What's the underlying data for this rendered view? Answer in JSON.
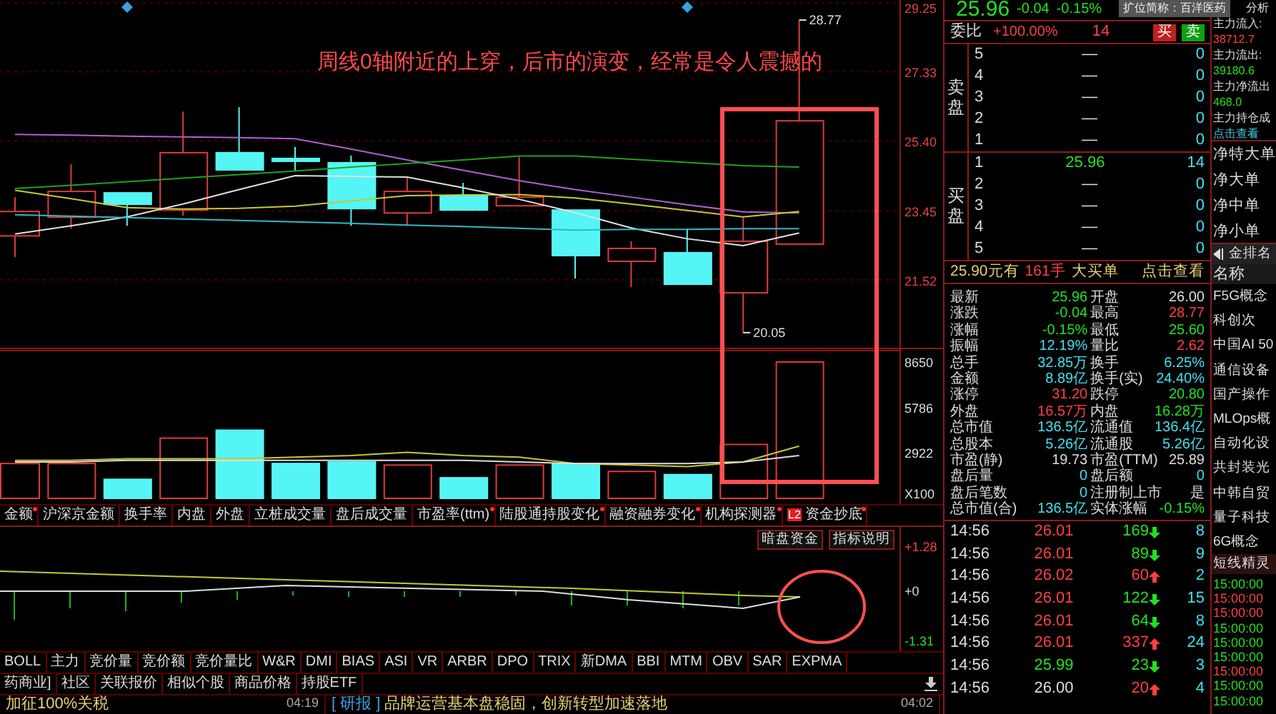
{
  "price_chart": {
    "annotation": "周线0轴附近的上穿，后市的演变，经常是令人震撼的",
    "high_label": "28.77",
    "low_label": "20.05",
    "chart_data": {
      "type": "line",
      "grid": true,
      "ylim": [
        19.61,
        29.33
      ],
      "yticks": [
        {
          "value": 21.52,
          "label": "21.52"
        },
        {
          "value": 23.45,
          "label": "23.45"
        },
        {
          "value": 25.4,
          "label": "25.40"
        },
        {
          "value": 27.33,
          "label": "27.33"
        },
        {
          "value": 29.25,
          "label": "29.25"
        }
      ],
      "series": [
        {
          "color": "#b060d0",
          "values": [
            25.58,
            25.56,
            25.53,
            25.51,
            25.49,
            25.46,
            25.17,
            24.87,
            24.58,
            24.29,
            24.04,
            23.83,
            23.62,
            23.42,
            23.39
          ]
        },
        {
          "color": "#20a020",
          "values": [
            24.07,
            24.16,
            24.26,
            24.36,
            24.46,
            24.56,
            24.67,
            24.77,
            24.87,
            24.98,
            24.98,
            24.89,
            24.8,
            24.71,
            24.67
          ]
        },
        {
          "color": "#c8c830",
          "values": [
            24.02,
            23.79,
            23.54,
            23.5,
            23.52,
            23.58,
            23.73,
            23.87,
            23.89,
            23.9,
            23.81,
            23.64,
            23.46,
            23.28,
            23.43
          ]
        },
        {
          "color": "#e0e0e0",
          "values": [
            22.8,
            23.03,
            23.28,
            23.64,
            24.04,
            24.43,
            24.41,
            24.39,
            24.09,
            23.77,
            23.4,
            22.97,
            22.67,
            22.48,
            22.83
          ]
        },
        {
          "color": "#30b8c8",
          "values": [
            23.34,
            23.3,
            23.26,
            23.22,
            23.18,
            23.14,
            23.1,
            23.05,
            23.01,
            22.96,
            22.91,
            22.93,
            22.93,
            22.95,
            22.95
          ]
        }
      ]
    }
  },
  "volume_chart": {
    "chart_data": {
      "type": "bar",
      "ylabel": "X100",
      "ylim": [
        0,
        9366
      ],
      "yticks": [
        2922,
        5786,
        8650
      ],
      "series": [
        {
          "color": "#e03a3a",
          "values": [
            2200,
            2200,
            null,
            3800,
            null,
            null,
            null,
            2100,
            null,
            2100,
            null,
            1700,
            null,
            3400,
            8600
          ]
        },
        {
          "color": "#55f5f5",
          "values": [
            null,
            null,
            1200,
            null,
            4300,
            2200,
            2300,
            null,
            1300,
            null,
            2200,
            null,
            1500,
            null,
            null
          ]
        },
        {
          "type": "line",
          "color": "#c8c830",
          "values": [
            2400,
            2400,
            2500,
            2500,
            2500,
            2600,
            2700,
            2900,
            2700,
            2600,
            2200,
            2100,
            2000,
            2300,
            3300
          ]
        },
        {
          "type": "line",
          "color": "#dddddd",
          "values": [
            2300,
            2300,
            2400,
            2400,
            2400,
            2400,
            2400,
            2400,
            2400,
            2300,
            2200,
            2200,
            2200,
            2300,
            2700
          ]
        }
      ]
    }
  },
  "data_tabs": [
    {
      "label": "金额",
      "dot": true
    },
    {
      "label": "沪深京金额",
      "dot": false
    },
    {
      "label": "换手率",
      "dot": false
    },
    {
      "label": "内盘",
      "dot": false
    },
    {
      "label": "外盘",
      "dot": false
    },
    {
      "label": "立桩成交量",
      "dot": false
    },
    {
      "label": "盘后成交量",
      "dot": false
    },
    {
      "label": "市盈率(ttm)",
      "dot": true
    },
    {
      "label": "陆股通持股变化",
      "dot": true
    },
    {
      "label": "融资融券变化",
      "dot": true
    },
    {
      "label": "机构探测器",
      "dot": true
    },
    {
      "label": "资金抄底",
      "dot": true,
      "badge": "L2"
    }
  ],
  "indicator_chart": {
    "buttons": [
      "暗盘资金",
      "指标说明"
    ],
    "axis_labels": [
      "+1.28",
      "+0",
      "-1.31"
    ]
  },
  "indicator_tabs": [
    "BOLL",
    "主力",
    "竞价量",
    "竞价额",
    "竞价量比",
    "W&R",
    "DMI",
    "BIAS",
    "ASI",
    "VR",
    "ARBR",
    "DPO",
    "TRIX",
    "新DMA",
    "BBI",
    "MTM",
    "OBV",
    "SAR",
    "EXPMA"
  ],
  "info_tabs": [
    "药商业]",
    "社区",
    "关联报价",
    "相似个股",
    "商品价格",
    "持股ETF"
  ],
  "news": [
    {
      "title": "加征100%关税",
      "time": "04:19"
    },
    {
      "tag": "[ 研报 ]",
      "title": "品牌运营基本盘稳固，创新转型加速落地",
      "time": "04:02"
    }
  ],
  "quote": {
    "price": "25.96",
    "change": "-0.04",
    "percent": "-0.15%",
    "tooltip": "扩位简称：百洋医药"
  },
  "weibi": {
    "label": "委比",
    "value": "+100.00%",
    "diff": "14",
    "buttons": [
      {
        "label": "买",
        "kind": "buy"
      },
      {
        "label": "卖",
        "kind": "sell"
      }
    ]
  },
  "sell_side": {
    "side_label": "卖盘",
    "levels": [
      {
        "level": "5",
        "price": "—",
        "volume": "0",
        "color": "#dddddd"
      },
      {
        "level": "4",
        "price": "—",
        "volume": "0",
        "color": "#dddddd"
      },
      {
        "level": "3",
        "price": "—",
        "volume": "0",
        "color": "#dddddd"
      },
      {
        "level": "2",
        "price": "—",
        "volume": "0",
        "color": "#dddddd"
      },
      {
        "level": "1",
        "price": "—",
        "volume": "0",
        "color": "#dddddd"
      }
    ]
  },
  "buy_side": {
    "side_label": "买盘",
    "levels": [
      {
        "level": "1",
        "price": "25.96",
        "volume": "14",
        "color": "#22e022"
      },
      {
        "level": "2",
        "price": "—",
        "volume": "0",
        "color": "#dddddd"
      },
      {
        "level": "3",
        "price": "—",
        "volume": "0",
        "color": "#dddddd"
      },
      {
        "level": "4",
        "price": "—",
        "volume": "0",
        "color": "#dddddd"
      },
      {
        "level": "5",
        "price": "—",
        "volume": "0",
        "color": "#dddddd"
      }
    ]
  },
  "big_order": {
    "price": "25.90元有",
    "lots": "161手",
    "type": "大买单",
    "link": "点击查看"
  },
  "stats": [
    {
      "label": "最新",
      "value": "25.96",
      "color": "#22e022"
    },
    {
      "label": "开盘",
      "value": "26.00",
      "color": "#dddddd"
    },
    {
      "label": "涨跌",
      "value": "-0.04",
      "color": "#22e022"
    },
    {
      "label": "最高",
      "value": "28.77",
      "color": "#ff4040"
    },
    {
      "label": "涨幅",
      "value": "-0.15%",
      "color": "#22e022"
    },
    {
      "label": "最低",
      "value": "25.60",
      "color": "#22e022"
    },
    {
      "label": "振幅",
      "value": "12.19%",
      "color": "#40e0f0"
    },
    {
      "label": "量比",
      "value": "2.62",
      "color": "#ff4040"
    },
    {
      "label": "总手",
      "value": "32.85万",
      "color": "#40e0f0"
    },
    {
      "label": "换手",
      "value": "6.25%",
      "color": "#40e0f0"
    },
    {
      "label": "金额",
      "value": "8.89亿",
      "color": "#40e0f0"
    },
    {
      "label": "换手(实)",
      "value": "24.40%",
      "color": "#40e0f0"
    },
    {
      "label": "涨停",
      "value": "31.20",
      "color": "#ff4040"
    },
    {
      "label": "跌停",
      "value": "20.80",
      "color": "#22e022"
    },
    {
      "label": "外盘",
      "value": "16.57万",
      "color": "#ff4040"
    },
    {
      "label": "内盘",
      "value": "16.28万",
      "color": "#22e022"
    },
    {
      "label": "总市值",
      "value": "136.5亿",
      "color": "#40e0f0"
    },
    {
      "label": "流通值",
      "value": "136.4亿",
      "color": "#40e0f0"
    },
    {
      "label": "总股本",
      "value": "5.26亿",
      "color": "#40e0f0"
    },
    {
      "label": "流通股",
      "value": "5.26亿",
      "color": "#40e0f0"
    },
    {
      "label": "市盈(静)",
      "value": "19.73",
      "color": "#dddddd"
    },
    {
      "label": "市盈(TTM)",
      "value": "25.89",
      "color": "#dddddd"
    },
    {
      "label": "盘后量",
      "value": "0",
      "color": "#40e0f0"
    },
    {
      "label": "盘后额",
      "value": "0",
      "color": "#40e0f0"
    },
    {
      "label": "盘后笔数",
      "value": "0",
      "color": "#40e0f0"
    },
    {
      "label": "注册制上市",
      "value": "是",
      "color": "#dddddd"
    },
    {
      "label": "总市值(合)",
      "value": "136.5亿",
      "color": "#40e0f0"
    },
    {
      "label": "实体涨幅",
      "value": "-0.15%",
      "color": "#22e022"
    }
  ],
  "ticks": [
    {
      "time": "14:56",
      "price": "26.01",
      "color": "#ff4040",
      "volume": "169",
      "kind": "down",
      "count": "8"
    },
    {
      "time": "14:56",
      "price": "26.01",
      "color": "#ff4040",
      "volume": "89",
      "kind": "down",
      "count": "9"
    },
    {
      "time": "14:56",
      "price": "26.02",
      "color": "#ff4040",
      "volume": "60",
      "kind": "up",
      "count": "2"
    },
    {
      "time": "14:56",
      "price": "26.01",
      "color": "#ff4040",
      "volume": "122",
      "kind": "down",
      "count": "15"
    },
    {
      "time": "14:56",
      "price": "26.01",
      "color": "#ff4040",
      "volume": "64",
      "kind": "down",
      "count": "8"
    },
    {
      "time": "14:56",
      "price": "26.01",
      "color": "#ff4040",
      "volume": "337",
      "kind": "up",
      "count": "24"
    },
    {
      "time": "14:56",
      "price": "25.99",
      "color": "#22e022",
      "volume": "23",
      "kind": "down",
      "count": "3"
    },
    {
      "time": "14:56",
      "price": "26.00",
      "color": "#dddddd",
      "volume": "20",
      "kind": "up",
      "count": "4"
    }
  ],
  "side_panel": {
    "title": "分析",
    "main_force": [
      {
        "label": "主力流入:",
        "value": "38712.7",
        "color": "#ff4040"
      },
      {
        "label": "主力流出:",
        "value": "39180.6",
        "color": "#22e022"
      },
      {
        "label": "主力净流出",
        "value": "468.0",
        "color": "#22e022"
      },
      {
        "label": "主力持仓成",
        "value": "点击查看",
        "color": "#40c8e0"
      }
    ],
    "net_orders": [
      "净特大单",
      "净大单",
      "净中单",
      "净小单"
    ],
    "ranking_header": "金排名",
    "column_header": "名称",
    "sectors": [
      "F5G概念",
      "科创次",
      "中国AI 50",
      "通信设备",
      "国产操作",
      "MLOps概",
      "自动化设",
      "共封装光",
      "中韩自贸",
      "量子科技",
      "6G概念"
    ],
    "signals_header": "短线精灵",
    "signals": [
      {
        "time": "15:00:00",
        "color": "#22e022"
      },
      {
        "time": "15:00:00",
        "color": "#ff4040"
      },
      {
        "time": "15:00:00",
        "color": "#ff4040"
      },
      {
        "time": "15:00:00",
        "color": "#22e022"
      },
      {
        "time": "15:00:00",
        "color": "#22e022"
      },
      {
        "time": "15:00:00",
        "color": "#22e022"
      },
      {
        "time": "15:00:00",
        "color": "#ff4040"
      },
      {
        "time": "15:00:00",
        "color": "#22e022"
      },
      {
        "time": "15:00:00",
        "color": "#22e022"
      }
    ]
  }
}
